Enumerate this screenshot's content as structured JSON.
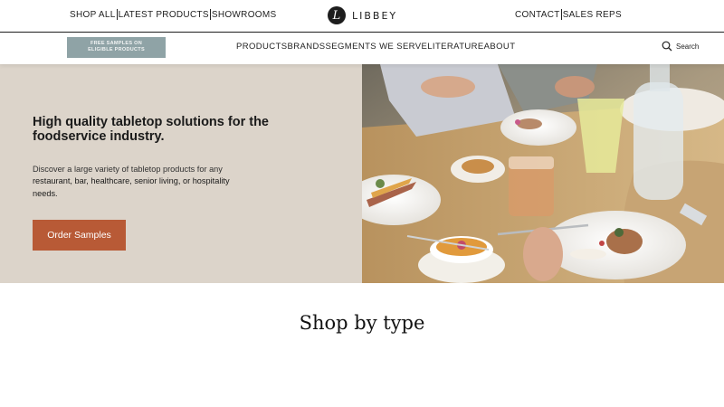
{
  "topbar": {
    "left_links": [
      "SHOP ALL",
      "LATEST PRODUCTS",
      "SHOWROOMS"
    ],
    "logo_text": "LIBBEY",
    "logo_mark": "L",
    "right_links": [
      "CONTACT",
      "SALES REPS"
    ]
  },
  "nav": {
    "promo_line1": "FREE SAMPLES ON",
    "promo_line2": "ELIGIBLE PRODUCTS",
    "items": [
      "PRODUCTS",
      "BRANDS",
      "SEGMENTS WE SERVE",
      "LITERATURE",
      "ABOUT"
    ],
    "search_label": "Search",
    "search_icon": "search-icon"
  },
  "hero": {
    "title": "High quality tabletop solutions for the foodservice industry.",
    "desc_part1": "Discover a large variety of tabletop products for any ",
    "desc_part2": "restaurant, bar, healthcare, senior living, or hospitality needs.",
    "cta_label": "Order Samples",
    "colors": {
      "panel": "#dcd4ca",
      "cta": "#b85a36",
      "promo": "#8fa3a6"
    }
  },
  "sections": {
    "shop_by_type": "Shop by type"
  }
}
